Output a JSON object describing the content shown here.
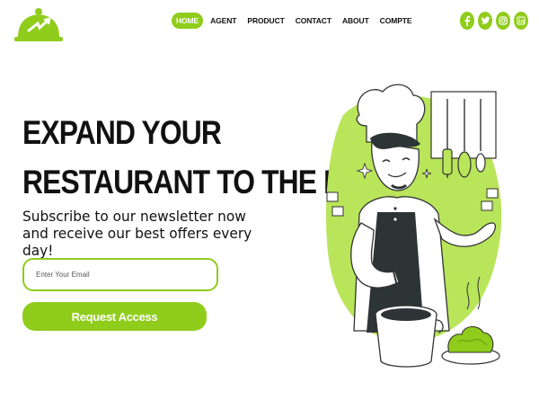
{
  "brand": {
    "logo_icon": "cloche-logo-icon",
    "accent_color": "#8fcc1b"
  },
  "nav": {
    "items": [
      {
        "label": "HOME",
        "active": true
      },
      {
        "label": "AGENT",
        "active": false
      },
      {
        "label": "PRODUCT",
        "active": false
      },
      {
        "label": "CONTACT",
        "active": false
      },
      {
        "label": "ABOUT",
        "active": false
      },
      {
        "label": "COMPTE",
        "active": false
      }
    ]
  },
  "social": {
    "icons": [
      "facebook-icon",
      "twitter-icon",
      "instagram-icon",
      "linkedin-icon"
    ]
  },
  "hero": {
    "title_line1": "EXPAND YOUR",
    "title_line2": "RESTAURANT TO THE BEST",
    "subtitle": "Subscribe to our newsletter now and receive our best offers every day!",
    "email_placeholder": "Enter Your Email",
    "cta_label": "Request Access",
    "illustration": "chef-cooking-illustration"
  }
}
